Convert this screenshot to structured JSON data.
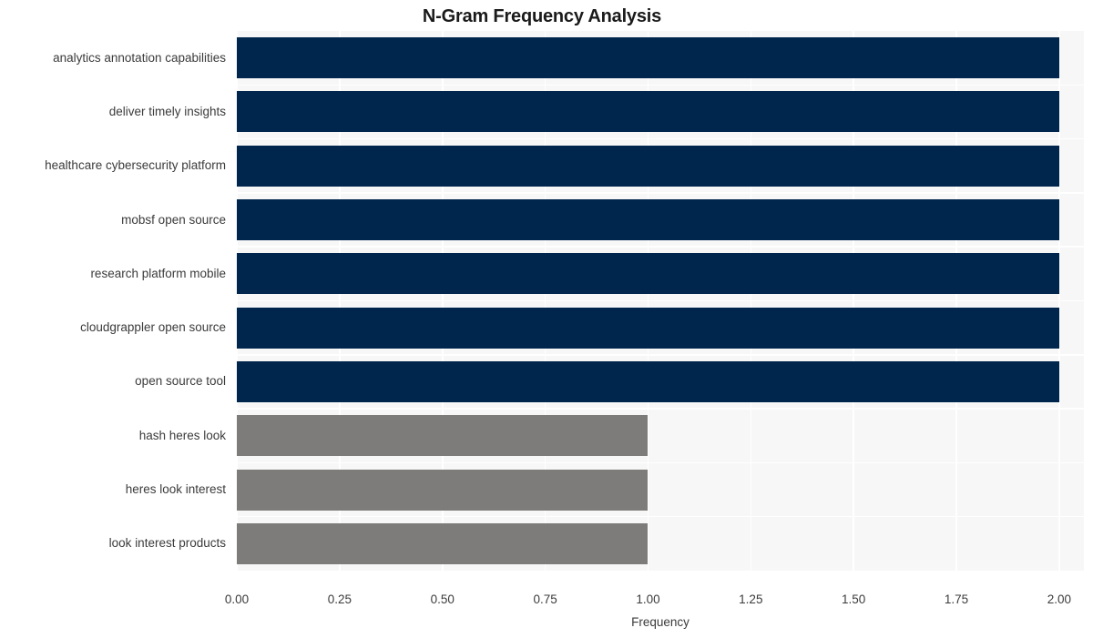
{
  "chart_data": {
    "type": "bar",
    "orientation": "horizontal",
    "title": "N-Gram Frequency Analysis",
    "xlabel": "Frequency",
    "ylabel": "",
    "xlim": [
      0,
      2.06
    ],
    "xticks": [
      "0.00",
      "0.25",
      "0.50",
      "0.75",
      "1.00",
      "1.25",
      "1.50",
      "1.75",
      "2.00"
    ],
    "xtick_values": [
      0,
      0.25,
      0.5,
      0.75,
      1.0,
      1.25,
      1.5,
      1.75,
      2.0
    ],
    "grid": true,
    "legend": "none",
    "categories": [
      "analytics annotation capabilities",
      "deliver timely insights",
      "healthcare cybersecurity platform",
      "mobsf open source",
      "research platform mobile",
      "cloudgrappler open source",
      "open source tool",
      "hash heres look",
      "heres look interest",
      "look interest products"
    ],
    "values": [
      2,
      2,
      2,
      2,
      2,
      2,
      2,
      1,
      1,
      1
    ],
    "colors": [
      "#00264d",
      "#00264d",
      "#00264d",
      "#00264d",
      "#00264d",
      "#00264d",
      "#00264d",
      "#7d7c7a",
      "#7d7c7a",
      "#7d7c7a"
    ],
    "palette": {
      "high": "#00264d",
      "low": "#7d7c7a",
      "plot_background": "#f7f7f7",
      "gridline": "#ffffff",
      "figure_background": "#ffffff",
      "text": "#3b3b3b",
      "title_text": "#1a1a1a"
    }
  }
}
